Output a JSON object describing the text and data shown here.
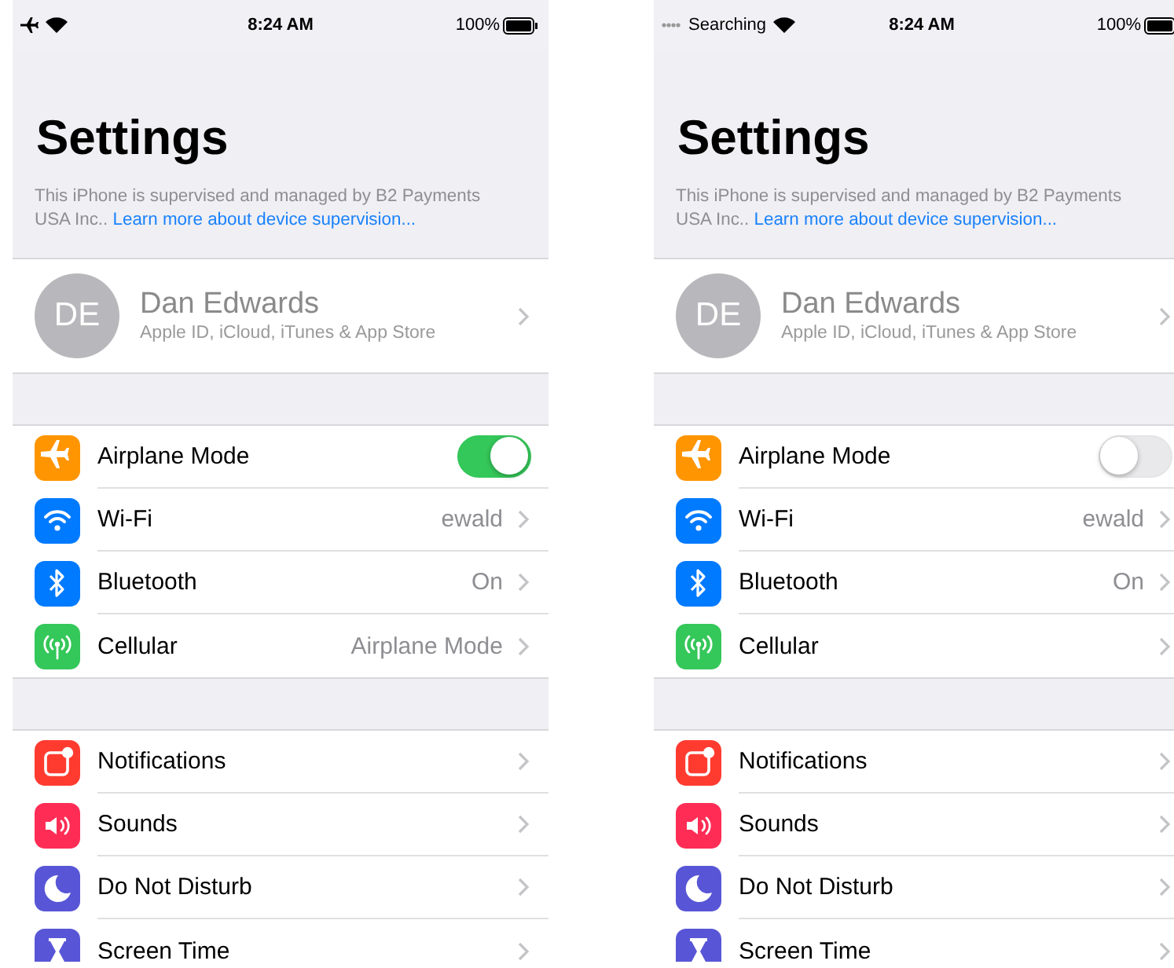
{
  "phones": [
    {
      "status_bar": {
        "airplane": true,
        "time": "8:24 AM",
        "battery": "100%"
      },
      "title": "Settings",
      "supervision": {
        "text": "This iPhone is supervised and managed by B2 Payments USA Inc..",
        "link": "Learn more about device supervision..."
      },
      "profile": {
        "initials": "DE",
        "name": "Dan Edwards",
        "subtitle": "Apple ID, iCloud, iTunes & App Store"
      },
      "groups": [
        [
          {
            "kind": "toggle",
            "label": "Airplane Mode",
            "on": true,
            "color": "#ff9500"
          },
          {
            "kind": "link",
            "label": "Wi-Fi",
            "value": "ewald",
            "color": "#007aff"
          },
          {
            "kind": "link",
            "label": "Bluetooth",
            "value": "On",
            "color": "#007aff"
          },
          {
            "kind": "link",
            "label": "Cellular",
            "value": "Airplane Mode",
            "color": "#34c759"
          }
        ],
        [
          {
            "kind": "link",
            "label": "Notifications",
            "color": "#ff3b30"
          },
          {
            "kind": "link",
            "label": "Sounds",
            "color": "#ff2d55"
          },
          {
            "kind": "link",
            "label": "Do Not Disturb",
            "color": "#5856d6"
          },
          {
            "kind": "link",
            "label": "Screen Time",
            "color": "#5856d6"
          }
        ]
      ]
    },
    {
      "status_bar": {
        "airplane": false,
        "carrier": "Searching",
        "time": "8:24 AM",
        "battery": "100%"
      },
      "title": "Settings",
      "supervision": {
        "text": "This iPhone is supervised and managed by B2 Payments USA Inc..",
        "link": "Learn more about device supervision..."
      },
      "profile": {
        "initials": "DE",
        "name": "Dan Edwards",
        "subtitle": "Apple ID, iCloud, iTunes & App Store"
      },
      "groups": [
        [
          {
            "kind": "toggle",
            "label": "Airplane Mode",
            "on": false,
            "color": "#ff9500"
          },
          {
            "kind": "link",
            "label": "Wi-Fi",
            "value": "ewald",
            "color": "#007aff"
          },
          {
            "kind": "link",
            "label": "Bluetooth",
            "value": "On",
            "color": "#007aff"
          },
          {
            "kind": "link",
            "label": "Cellular",
            "color": "#34c759"
          }
        ],
        [
          {
            "kind": "link",
            "label": "Notifications",
            "color": "#ff3b30"
          },
          {
            "kind": "link",
            "label": "Sounds",
            "color": "#ff2d55"
          },
          {
            "kind": "link",
            "label": "Do Not Disturb",
            "color": "#5856d6"
          },
          {
            "kind": "link",
            "label": "Screen Time",
            "color": "#5856d6"
          }
        ]
      ]
    }
  ]
}
